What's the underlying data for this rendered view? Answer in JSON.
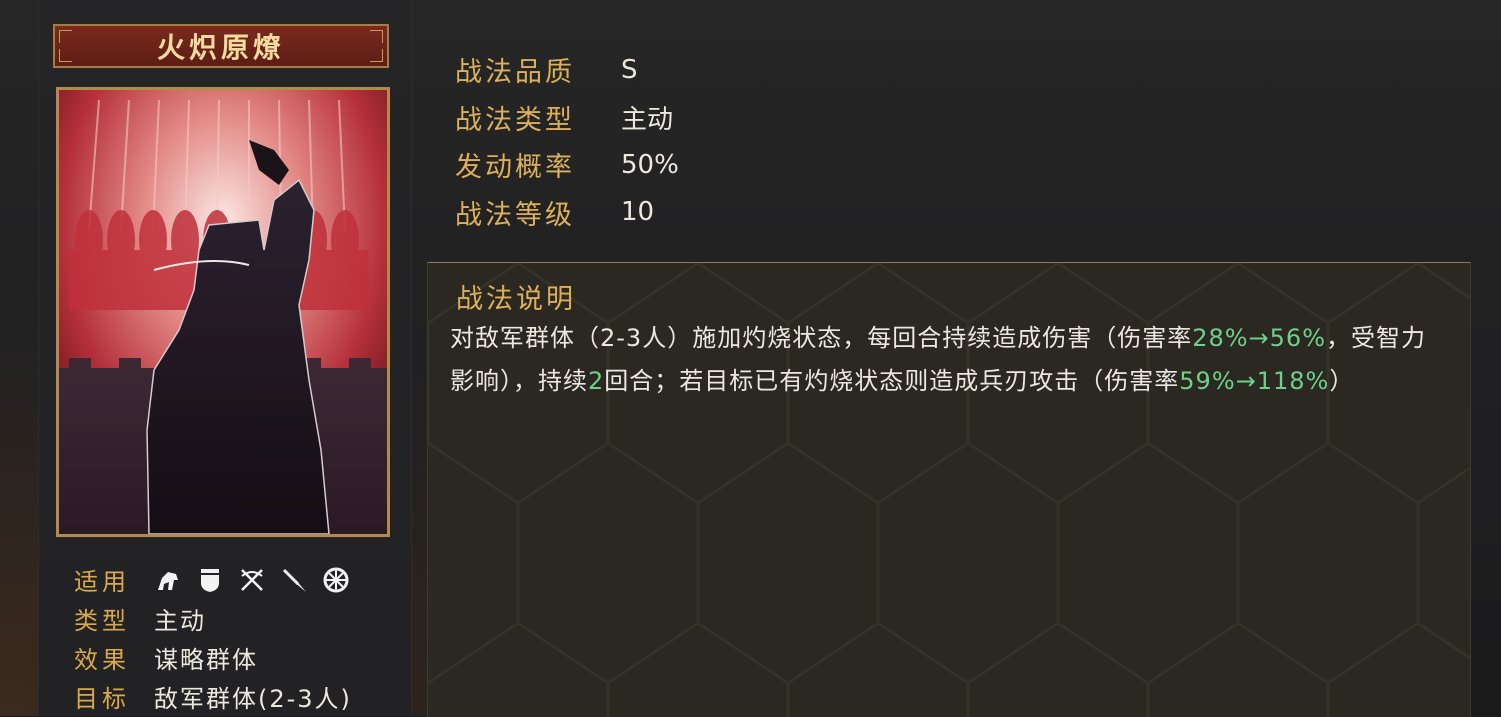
{
  "skill": {
    "name": "火炽原燎",
    "quality_label": "战法品质",
    "quality_value": "S",
    "type_label": "战法类型",
    "type_value": "主动",
    "rate_label": "发动概率",
    "rate_value": "50%",
    "level_label": "战法等级",
    "level_value": "10"
  },
  "attrs": {
    "apply_label": "适用",
    "apply_icons": [
      "cavalry-icon",
      "shield-icon",
      "bow-icon",
      "spear-icon",
      "wheel-icon"
    ],
    "type_label": "类型",
    "type_value": "主动",
    "effect_label": "效果",
    "effect_value": "谋略群体",
    "target_label": "目标",
    "target_value": "敌军群体(2-3人)"
  },
  "description": {
    "title": "战法说明",
    "parts": [
      {
        "text": "对敌军群体（2-3人）施加灼烧状态，每回合持续造成伤害（伤害率",
        "hl": false
      },
      {
        "text": "28%→56%",
        "hl": true
      },
      {
        "text": "，受智力影响），持续",
        "hl": false
      },
      {
        "text": "2",
        "hl": true
      },
      {
        "text": "回合；若目标已有灼烧状态则造成兵刃攻击（伤害率",
        "hl": false
      },
      {
        "text": "59%→118%",
        "hl": true
      },
      {
        "text": "）",
        "hl": false
      }
    ]
  },
  "colors": {
    "gold_label": "#dcb05a",
    "highlight_green": "#6fcf8b",
    "title_bar": "#7a2a1d",
    "card_border": "#b38a4d"
  }
}
